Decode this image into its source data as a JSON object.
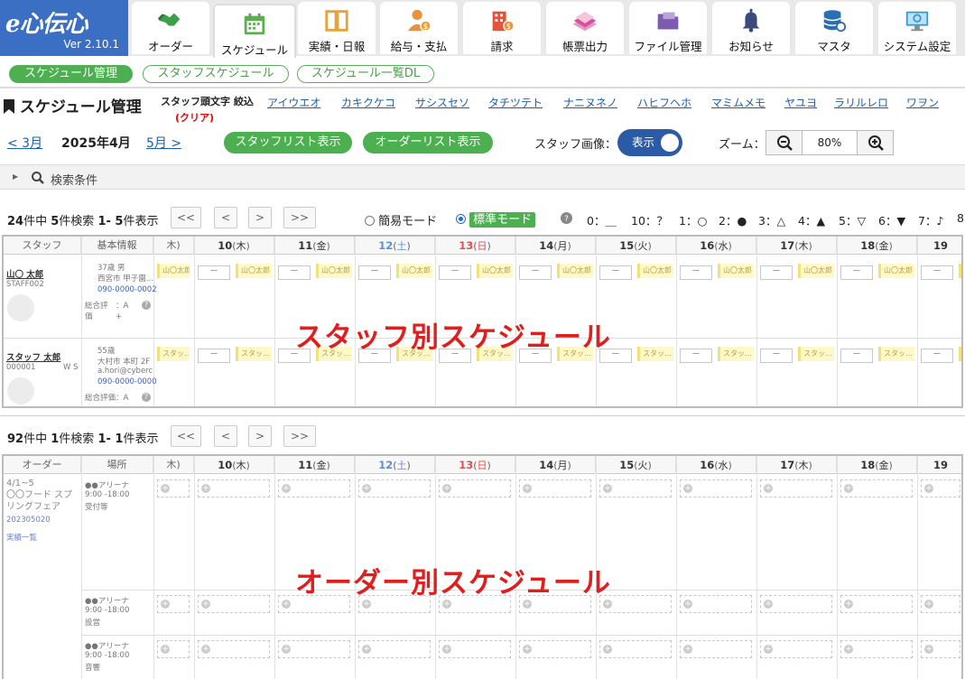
{
  "app": {
    "brand": "e心伝心",
    "version": "Ver 2.10.1"
  },
  "nav": [
    {
      "label": "オーダー",
      "icon": "handshake-icon",
      "color": "#3aa04a"
    },
    {
      "label": "スケジュール",
      "icon": "calendar-icon",
      "color": "#58b24a"
    },
    {
      "label": "実績・日報",
      "icon": "book-icon",
      "color": "#e8a23a"
    },
    {
      "label": "給与・支払",
      "icon": "person-money-icon",
      "color": "#e8933a"
    },
    {
      "label": "請求",
      "icon": "building-money-icon",
      "color": "#e2553a"
    },
    {
      "label": "帳票出力",
      "icon": "papers-icon",
      "color": "#d94f9c"
    },
    {
      "label": "ファイル管理",
      "icon": "folder-icon",
      "color": "#7d5bb0"
    },
    {
      "label": "お知らせ",
      "icon": "bell-icon",
      "color": "#3a4a7a"
    },
    {
      "label": "マスタ",
      "icon": "database-icon",
      "color": "#2a6fb4"
    },
    {
      "label": "システム設定",
      "icon": "monitor-gear-icon",
      "color": "#3a9bd4"
    }
  ],
  "subtabs": [
    "スケジュール管理",
    "スタッフスケジュール",
    "スケジュール一覧DL"
  ],
  "page_title": "スケジュール管理",
  "kana_filter": {
    "label": "スタッフ頭文字 絞込",
    "clear": "(クリア)",
    "letters": [
      "アイウエオ",
      "カキクケコ",
      "サシスセソ",
      "タチツテト",
      "ナニヌネノ",
      "ハヒフヘホ",
      "マミムメモ",
      "ヤユヨ",
      "ラリルレロ",
      "ワヲン"
    ]
  },
  "month": {
    "prev": "< 3月",
    "current": "2025年4月",
    "next": "5月 >"
  },
  "buttons": {
    "staff_list": "スタッフリスト表示",
    "order_list": "オーダーリスト表示"
  },
  "staff_image": {
    "label": "スタッフ画像：",
    "toggle": "表示"
  },
  "zoom": {
    "label": "ズーム：",
    "value": "80%"
  },
  "search": {
    "label": "検索条件"
  },
  "staff_section": {
    "count": {
      "total": "24",
      "total_unit": "件中",
      "found": "5",
      "found_unit": "件検索",
      "range": "1- 5",
      "range_unit": "件表示"
    },
    "pager": [
      "<<",
      "<",
      ">",
      ">>"
    ],
    "modes": {
      "simple": "簡易モード",
      "standard": "標準モード"
    },
    "legend": [
      "0：＿",
      "10：？",
      "1：○",
      "2：●",
      "3：△",
      "4：▲",
      "5：▽",
      "6：▼",
      "7：♪",
      "8"
    ],
    "headers": {
      "staff": "スタッフ",
      "info": "基本情報"
    },
    "days": [
      {
        "d": "",
        "w": "木"
      },
      {
        "d": "10",
        "w": "木"
      },
      {
        "d": "11",
        "w": "金"
      },
      {
        "d": "12",
        "w": "土"
      },
      {
        "d": "13",
        "w": "日"
      },
      {
        "d": "14",
        "w": "月"
      },
      {
        "d": "15",
        "w": "火"
      },
      {
        "d": "16",
        "w": "水"
      },
      {
        "d": "17",
        "w": "木"
      },
      {
        "d": "18",
        "w": "金"
      },
      {
        "d": "19",
        "w": ""
      }
    ],
    "rows": [
      {
        "name": "山〇 太郎",
        "code": "STAFF002",
        "age": "37歳 男",
        "addr": "西宮市 甲子園…",
        "tel": "090-0000-0002",
        "rating": "総合評　：A",
        "rating2": "価　　　+",
        "chip": "山〇太郎"
      },
      {
        "name": "スタッフ 太郎",
        "code": "000001",
        "tag": "W S",
        "age": "55歳",
        "addr": "大村市 本町 2F",
        "mail": "a.hori@cyberc…",
        "tel": "090-0000-0000",
        "rating": "総合評価：A",
        "chip": "スタッ…"
      }
    ],
    "dash": "ー",
    "overlay": "スタッフ別スケジュール"
  },
  "order_section": {
    "count": {
      "total": "92",
      "total_unit": "件中",
      "found": "1",
      "found_unit": "件検索",
      "range": "1- 1",
      "range_unit": "件表示"
    },
    "pager": [
      "<<",
      "<",
      ">",
      ">>"
    ],
    "headers": {
      "order": "オーダー",
      "place": "場所"
    },
    "order": {
      "period": "4/1~5",
      "name": "〇〇フード スプリングフェア",
      "code": "202305020",
      "link": "実績一覧"
    },
    "places": [
      {
        "name": "●●アリーナ",
        "time": "9:00 -18:00",
        "role": "受付等"
      },
      {
        "name": "●●アリーナ",
        "time": "9:00 -18:00",
        "role": "設営"
      },
      {
        "name": "●●アリーナ",
        "time": "9:00 -18:00",
        "role": "音響"
      }
    ],
    "overlay": "オーダー別スケジュール"
  }
}
